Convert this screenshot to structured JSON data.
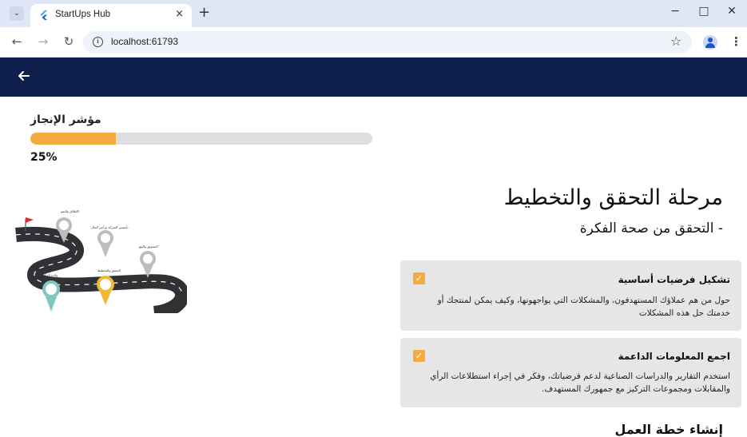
{
  "browser": {
    "tab_title": "StartUps Hub",
    "tab_close": "×",
    "new_tab": "+",
    "url": "localhost:61793",
    "window_minimize": "−",
    "window_maximize": "□",
    "window_close": "✕"
  },
  "app": {
    "progress_label": "مؤشر الإنجاز",
    "progress_value_text": "25%",
    "progress_fraction": 0.25,
    "accent_color": "#f4ab40",
    "appbar_color": "#0f1f4d"
  },
  "stage": {
    "title": "مرحلة التحقق والتخطيط",
    "subtitle": "- التحقق من صحة الفكرة"
  },
  "road_labels": [
    "الإطلاق والنمو",
    "تأسيس الشركة ورأس المال",
    "التسويق والبيع",
    "التحقق والتخطيط",
    "ولادة الفكرة"
  ],
  "tasks": [
    {
      "title": "تشكيل فرضيات أساسية",
      "description": "حول من هم عملاؤك المستهدفون، والمشكلات التي يواجهونها، وكيف يمكن لمنتجك أو خدمتك حل هذه المشكلات",
      "checked": true
    },
    {
      "title": "اجمع المعلومات الداعمة",
      "description": "استخدم التقارير والدراسات الصناعية لدعم فرضياتك، وفكر في إجراء استطلاعات الرأي والمقابلات ومجموعات التركيز مع جمهورك المستهدف.",
      "checked": true
    }
  ],
  "next_section_heading": "إنشاء خطة العمل"
}
